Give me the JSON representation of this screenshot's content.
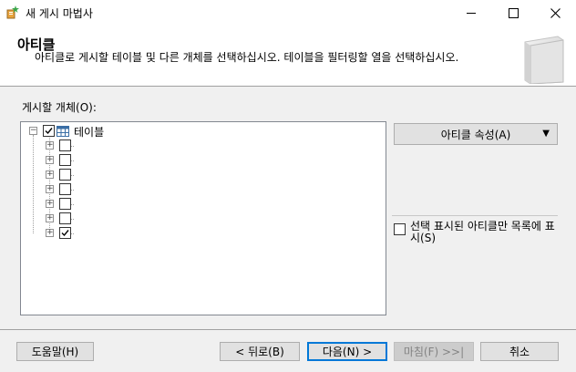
{
  "window": {
    "title": "새 게시 마법사",
    "minimize_icon": "minimize-icon",
    "maximize_icon": "maximize-icon",
    "close_icon": "close-icon"
  },
  "header": {
    "title": "아티클",
    "description": "아티클로 게시할 테이블 및 다른 개체를 선택하십시오. 테이블을 필터링할 열을 선택하십시오."
  },
  "objects": {
    "label": "게시할 개체(O):",
    "root": {
      "label": "테이블",
      "checked": true,
      "expanded": true,
      "icon": "table-icon"
    },
    "children": [
      {
        "label": "",
        "checked": false
      },
      {
        "label": "",
        "checked": false
      },
      {
        "label": "",
        "checked": false
      },
      {
        "label": "",
        "checked": false
      },
      {
        "label": "",
        "checked": false
      },
      {
        "label": "",
        "checked": false
      },
      {
        "label": "",
        "checked": true
      }
    ]
  },
  "article_properties_button": "아티클 속성(A)",
  "filter_checkbox": {
    "label": "선택 표시된 아티클만 목록에 표시(S)",
    "checked": false
  },
  "buttons": {
    "help": "도움말(H)",
    "back": "< 뒤로(B)",
    "next": "다음(N) >",
    "finish": "마침(F) >>|",
    "cancel": "취소"
  },
  "colors": {
    "accent": "#0078d7",
    "dialog_background": "#f0f0f0"
  }
}
